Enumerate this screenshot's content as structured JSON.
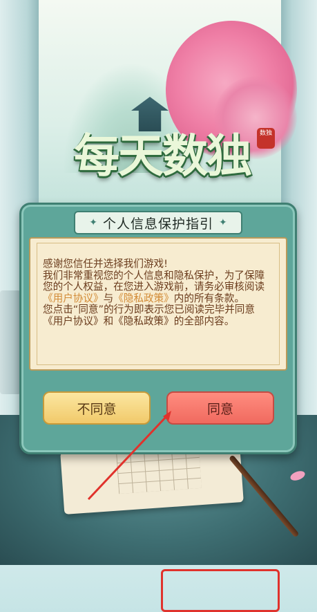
{
  "logo": {
    "text": "每天数独",
    "seal": "数独"
  },
  "dialog": {
    "title": "个人信息保护指引",
    "body": {
      "line1": "感谢您信任并选择我们游戏!",
      "p1_pre": "我们非常重视您的个人信息和隐私保护，为了保障您的个人权益，在您进入游戏前，请务必审核阅读",
      "link_user_agreement": "《用户协议》",
      "and": "与",
      "link_privacy_policy": "《隐私政策》",
      "p1_post": "内的所有条款。",
      "p2": "您点击“同意”的行为即表示您已阅读完毕并同意《用户协议》和《隐私政策》的全部内容。"
    },
    "buttons": {
      "disagree": "不同意",
      "agree": "同意"
    }
  },
  "colors": {
    "accent_highlight": "#e0322c",
    "agree": "#f06a5f",
    "disagree": "#f1c96a",
    "dialog": "#5ea69a"
  }
}
